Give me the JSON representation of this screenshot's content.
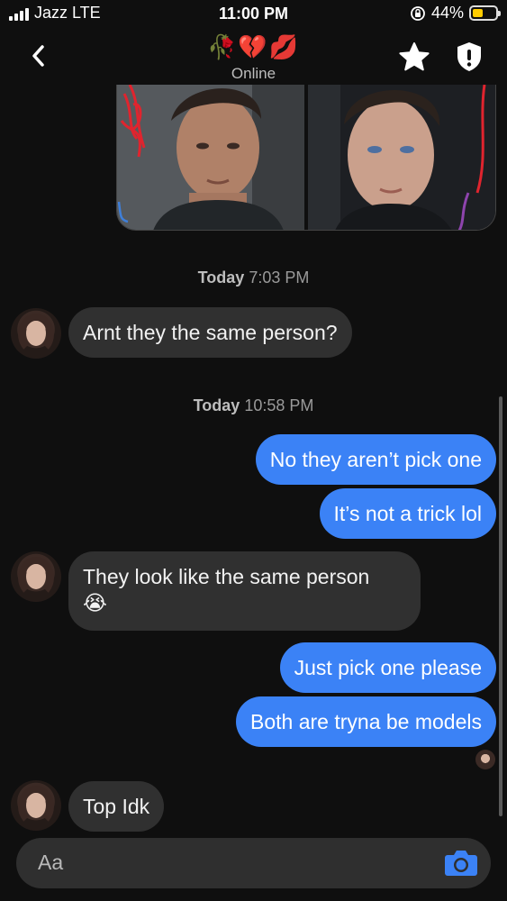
{
  "status_bar": {
    "carrier": "Jazz LTE",
    "time": "11:00 PM",
    "battery": "44%",
    "battery_level": 0.44
  },
  "header": {
    "contact_name": "🥀💔💋",
    "presence": "Online"
  },
  "messages": {
    "timestamp1": {
      "day": "Today",
      "time": "7:03 PM"
    },
    "m1": "Arnt they the same person?",
    "timestamp2": {
      "day": "Today",
      "time": "10:58 PM"
    },
    "m2": "No they aren’t pick one",
    "m3": "It’s not a trick lol",
    "m4_line1": "They look like the same person",
    "m4_line2": "😭",
    "m5": "Just pick one please",
    "m6": "Both are tryna be models",
    "m7": "Top Idk"
  },
  "composer": {
    "placeholder": "Aa"
  },
  "colors": {
    "outgoing_bubble": "#3b82f6",
    "incoming_bubble": "#303030",
    "background": "#0f0f0f"
  },
  "icons": [
    "back-icon",
    "star-icon",
    "shield-icon",
    "camera-icon"
  ]
}
